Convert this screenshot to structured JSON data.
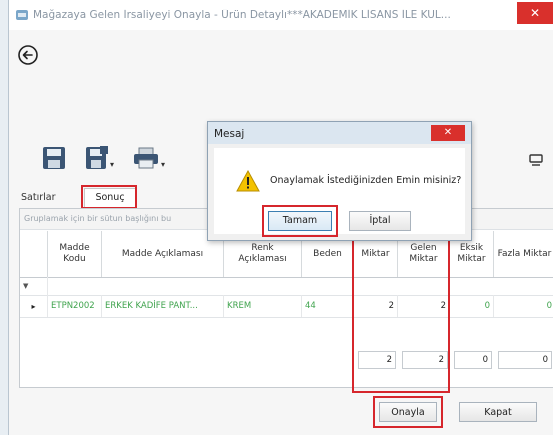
{
  "window": {
    "title": "Mağazaya Gelen İrsaliyeyi Onayla - Ürün Detaylı***AKADEMİK LİSANS İLE KUL...",
    "close_label": "✕"
  },
  "tabs": {
    "satirlar": "Satırlar",
    "sonuc": "Sonuç"
  },
  "grid": {
    "group_hint": "Gruplamak için bir sütun başlığını bu",
    "columns": [
      "Madde Kodu",
      "Madde Açıklaması",
      "Renk Açıklaması",
      "Beden",
      "Miktar",
      "Gelen Miktar",
      "Eksik Miktar",
      "Fazla Miktar"
    ],
    "filter_marker": "▼",
    "row_marker": "▸",
    "row": {
      "madde_kodu": "ETPN2002",
      "madde_aciklamasi": "ERKEK KADİFE PANT...",
      "renk": "KREM",
      "beden": "44",
      "miktar": "2",
      "gelen": "2",
      "eksik": "0",
      "fazla": "0"
    },
    "totals": {
      "miktar": "2",
      "gelen": "2",
      "eksik": "0",
      "fazla": "0"
    }
  },
  "footer": {
    "onayla": "Onayla",
    "kapat": "Kapat"
  },
  "dialog": {
    "title": "Mesaj",
    "close_label": "✕",
    "message": "Onaylamak İstediğinizden Emin misiniz?",
    "ok": "Tamam",
    "cancel": "İptal"
  },
  "colors": {
    "highlight": "#d6262c",
    "title_close": "#d9302c",
    "green_text": "#3fa34d"
  }
}
